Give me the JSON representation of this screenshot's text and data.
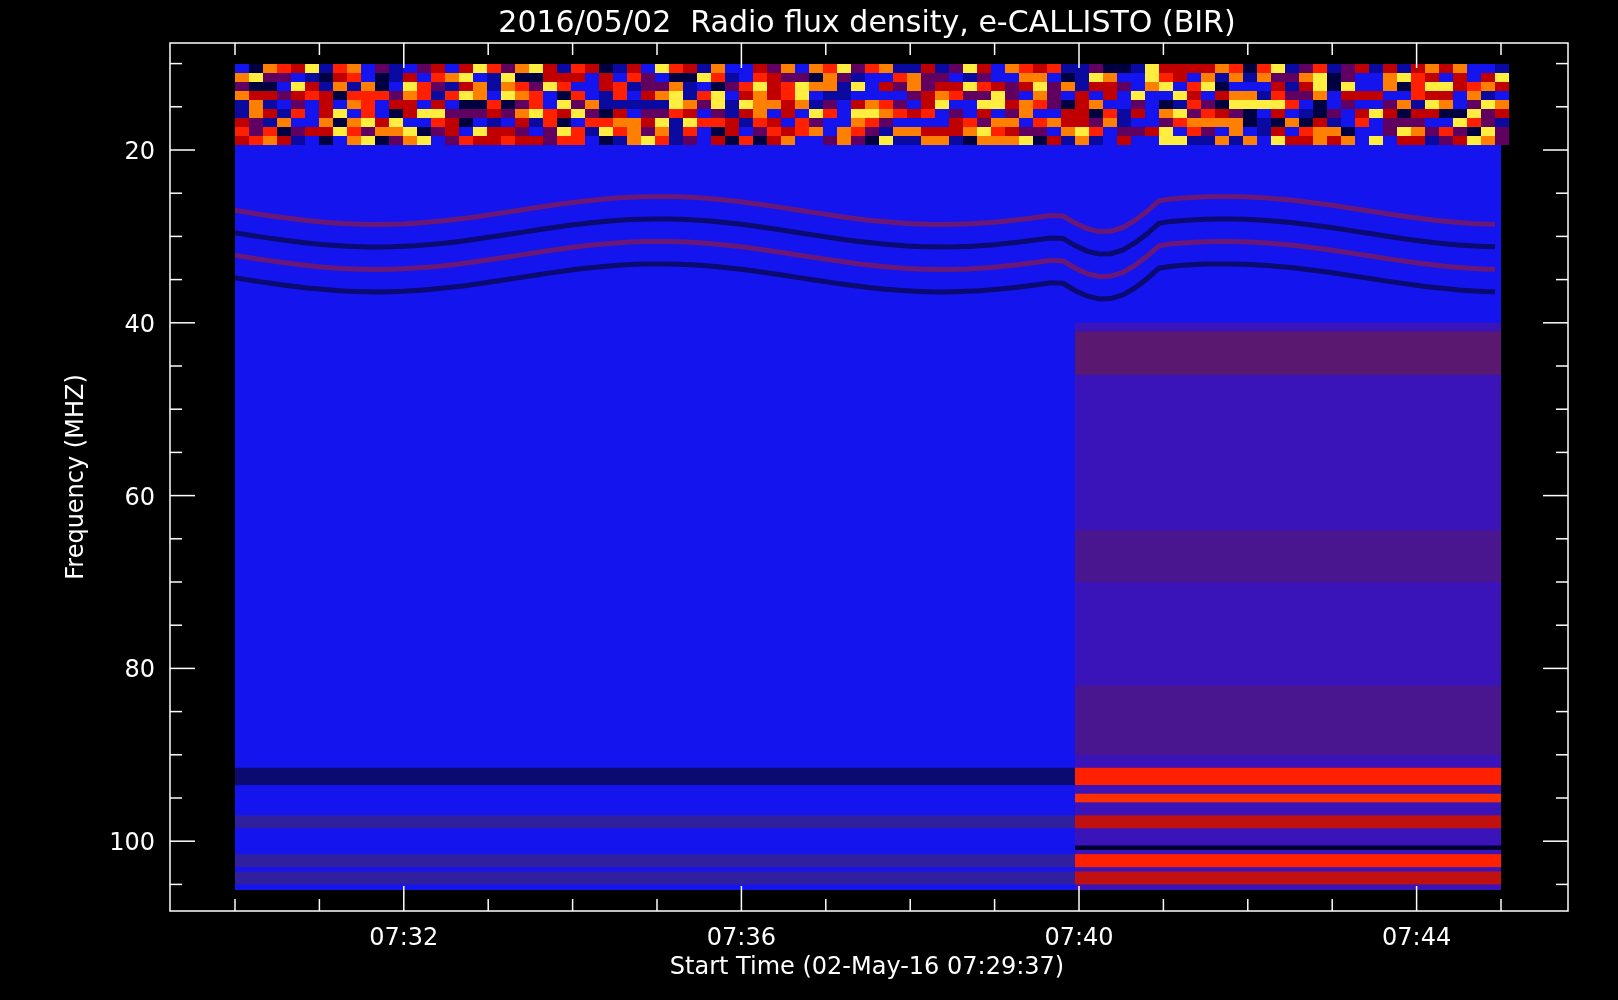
{
  "chart": {
    "title": "2016/05/02  Radio flux density, e-CALLISTO (BIR)",
    "ylabel": "Frequency (MHZ)",
    "xlabel": "Start Time (02-May-16 07:29:37)",
    "ytick_labels": [
      "20",
      "40",
      "60",
      "80",
      "100"
    ],
    "xtick_labels": [
      "07:32",
      "07:36",
      "07:40",
      "07:44"
    ]
  }
}
